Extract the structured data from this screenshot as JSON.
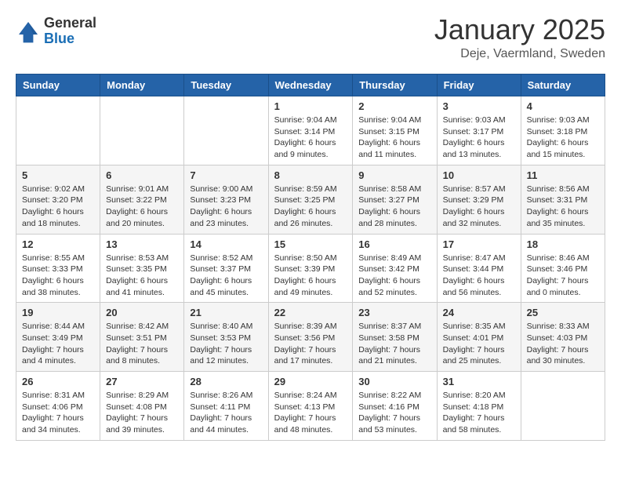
{
  "logo": {
    "general": "General",
    "blue": "Blue"
  },
  "header": {
    "month": "January 2025",
    "location": "Deje, Vaermland, Sweden"
  },
  "weekdays": [
    "Sunday",
    "Monday",
    "Tuesday",
    "Wednesday",
    "Thursday",
    "Friday",
    "Saturday"
  ],
  "weeks": [
    [
      {
        "day": "",
        "info": ""
      },
      {
        "day": "",
        "info": ""
      },
      {
        "day": "",
        "info": ""
      },
      {
        "day": "1",
        "info": "Sunrise: 9:04 AM\nSunset: 3:14 PM\nDaylight: 6 hours\nand 9 minutes."
      },
      {
        "day": "2",
        "info": "Sunrise: 9:04 AM\nSunset: 3:15 PM\nDaylight: 6 hours\nand 11 minutes."
      },
      {
        "day": "3",
        "info": "Sunrise: 9:03 AM\nSunset: 3:17 PM\nDaylight: 6 hours\nand 13 minutes."
      },
      {
        "day": "4",
        "info": "Sunrise: 9:03 AM\nSunset: 3:18 PM\nDaylight: 6 hours\nand 15 minutes."
      }
    ],
    [
      {
        "day": "5",
        "info": "Sunrise: 9:02 AM\nSunset: 3:20 PM\nDaylight: 6 hours\nand 18 minutes."
      },
      {
        "day": "6",
        "info": "Sunrise: 9:01 AM\nSunset: 3:22 PM\nDaylight: 6 hours\nand 20 minutes."
      },
      {
        "day": "7",
        "info": "Sunrise: 9:00 AM\nSunset: 3:23 PM\nDaylight: 6 hours\nand 23 minutes."
      },
      {
        "day": "8",
        "info": "Sunrise: 8:59 AM\nSunset: 3:25 PM\nDaylight: 6 hours\nand 26 minutes."
      },
      {
        "day": "9",
        "info": "Sunrise: 8:58 AM\nSunset: 3:27 PM\nDaylight: 6 hours\nand 28 minutes."
      },
      {
        "day": "10",
        "info": "Sunrise: 8:57 AM\nSunset: 3:29 PM\nDaylight: 6 hours\nand 32 minutes."
      },
      {
        "day": "11",
        "info": "Sunrise: 8:56 AM\nSunset: 3:31 PM\nDaylight: 6 hours\nand 35 minutes."
      }
    ],
    [
      {
        "day": "12",
        "info": "Sunrise: 8:55 AM\nSunset: 3:33 PM\nDaylight: 6 hours\nand 38 minutes."
      },
      {
        "day": "13",
        "info": "Sunrise: 8:53 AM\nSunset: 3:35 PM\nDaylight: 6 hours\nand 41 minutes."
      },
      {
        "day": "14",
        "info": "Sunrise: 8:52 AM\nSunset: 3:37 PM\nDaylight: 6 hours\nand 45 minutes."
      },
      {
        "day": "15",
        "info": "Sunrise: 8:50 AM\nSunset: 3:39 PM\nDaylight: 6 hours\nand 49 minutes."
      },
      {
        "day": "16",
        "info": "Sunrise: 8:49 AM\nSunset: 3:42 PM\nDaylight: 6 hours\nand 52 minutes."
      },
      {
        "day": "17",
        "info": "Sunrise: 8:47 AM\nSunset: 3:44 PM\nDaylight: 6 hours\nand 56 minutes."
      },
      {
        "day": "18",
        "info": "Sunrise: 8:46 AM\nSunset: 3:46 PM\nDaylight: 7 hours\nand 0 minutes."
      }
    ],
    [
      {
        "day": "19",
        "info": "Sunrise: 8:44 AM\nSunset: 3:49 PM\nDaylight: 7 hours\nand 4 minutes."
      },
      {
        "day": "20",
        "info": "Sunrise: 8:42 AM\nSunset: 3:51 PM\nDaylight: 7 hours\nand 8 minutes."
      },
      {
        "day": "21",
        "info": "Sunrise: 8:40 AM\nSunset: 3:53 PM\nDaylight: 7 hours\nand 12 minutes."
      },
      {
        "day": "22",
        "info": "Sunrise: 8:39 AM\nSunset: 3:56 PM\nDaylight: 7 hours\nand 17 minutes."
      },
      {
        "day": "23",
        "info": "Sunrise: 8:37 AM\nSunset: 3:58 PM\nDaylight: 7 hours\nand 21 minutes."
      },
      {
        "day": "24",
        "info": "Sunrise: 8:35 AM\nSunset: 4:01 PM\nDaylight: 7 hours\nand 25 minutes."
      },
      {
        "day": "25",
        "info": "Sunrise: 8:33 AM\nSunset: 4:03 PM\nDaylight: 7 hours\nand 30 minutes."
      }
    ],
    [
      {
        "day": "26",
        "info": "Sunrise: 8:31 AM\nSunset: 4:06 PM\nDaylight: 7 hours\nand 34 minutes."
      },
      {
        "day": "27",
        "info": "Sunrise: 8:29 AM\nSunset: 4:08 PM\nDaylight: 7 hours\nand 39 minutes."
      },
      {
        "day": "28",
        "info": "Sunrise: 8:26 AM\nSunset: 4:11 PM\nDaylight: 7 hours\nand 44 minutes."
      },
      {
        "day": "29",
        "info": "Sunrise: 8:24 AM\nSunset: 4:13 PM\nDaylight: 7 hours\nand 48 minutes."
      },
      {
        "day": "30",
        "info": "Sunrise: 8:22 AM\nSunset: 4:16 PM\nDaylight: 7 hours\nand 53 minutes."
      },
      {
        "day": "31",
        "info": "Sunrise: 8:20 AM\nSunset: 4:18 PM\nDaylight: 7 hours\nand 58 minutes."
      },
      {
        "day": "",
        "info": ""
      }
    ]
  ]
}
